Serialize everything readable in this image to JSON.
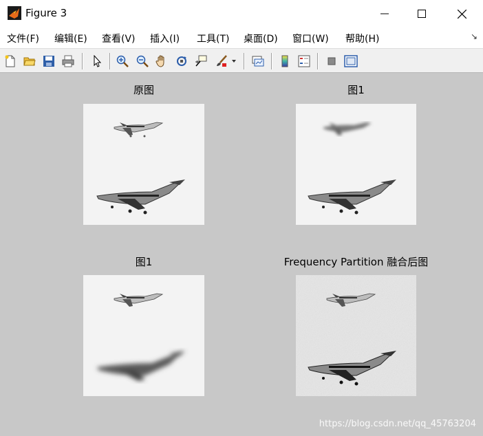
{
  "window": {
    "title": "Figure 3",
    "controls": [
      "minimize",
      "maximize",
      "close"
    ]
  },
  "menu": [
    {
      "label": "文件(F)"
    },
    {
      "label": "编辑(E)"
    },
    {
      "label": "查看(V)"
    },
    {
      "label": "插入(I)"
    },
    {
      "label": "工具(T)"
    },
    {
      "label": "桌面(D)"
    },
    {
      "label": "窗口(W)"
    },
    {
      "label": "帮助(H)"
    }
  ],
  "toolbar": {
    "icons": [
      "new-figure-icon",
      "open-file-icon",
      "save-icon",
      "print-icon",
      "edit-plot-arrow-icon",
      "zoom-in-icon",
      "zoom-out-icon",
      "pan-hand-icon",
      "rotate-3d-icon",
      "data-cursor-icon",
      "brush-icon",
      "brush-dropdown-icon",
      "link-plot-icon",
      "colorbar-icon",
      "legend-icon",
      "hide-plot-tools-icon",
      "show-plot-tools-icon"
    ]
  },
  "subplots": [
    {
      "title": "原图",
      "image": "two airplanes, both sharp"
    },
    {
      "title": "图1",
      "image": "top airplane blurred, bottom airplane sharp"
    },
    {
      "title": "图1",
      "image": "top airplane sharp, bottom airplane blurred"
    },
    {
      "title": "Frequency Partition 融合后图",
      "image": "fused image, both airplanes sharp, textured background"
    }
  ],
  "watermark": "https://blog.csdn.net/qq_45763204",
  "colors": {
    "figure_background": "#c8c8c8",
    "titlebar": "#ffffff",
    "toolbar": "#f0f0f0"
  }
}
